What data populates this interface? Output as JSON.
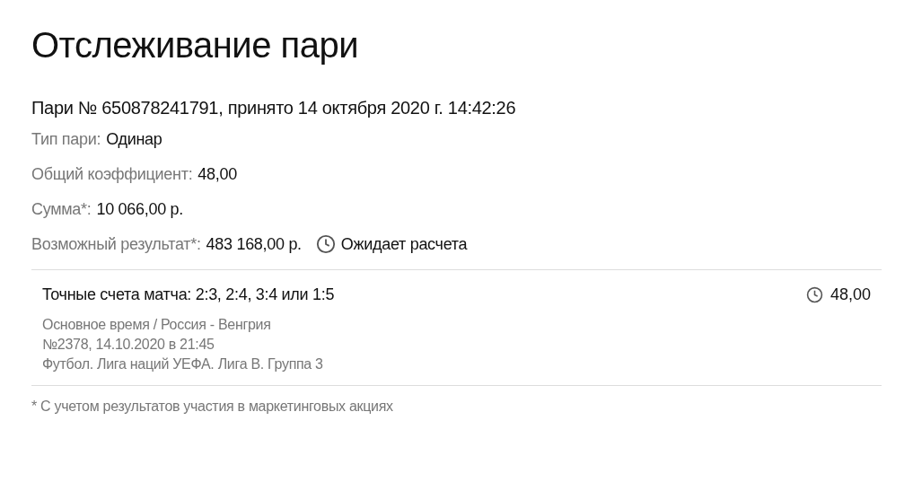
{
  "title": "Отслеживание пари",
  "bet_header": "Пари № 650878241791, принято 14 октября 2020 г. 14:42:26",
  "details": [
    {
      "label": "Тип пари:",
      "value": "Одинар"
    },
    {
      "label": "Общий коэффициент:",
      "value": "48,00"
    },
    {
      "label": "Сумма*:",
      "value": "10 066,00 р."
    },
    {
      "label": "Возможный результат*:",
      "value": "483 168,00 р.",
      "status": "Ожидает расчета"
    }
  ],
  "selection": {
    "outcome": "Точные счета матча: 2:3, 2:4, 3:4 или 1:5",
    "odds": "48,00",
    "lines": [
      "Основное время / Россия - Венгрия",
      "№2378, 14.10.2020 в 21:45",
      "Футбол. Лига наций УЕФА. Лига B. Группа 3"
    ]
  },
  "footnote": "* С учетом результатов участия в маркетинговых акциях"
}
